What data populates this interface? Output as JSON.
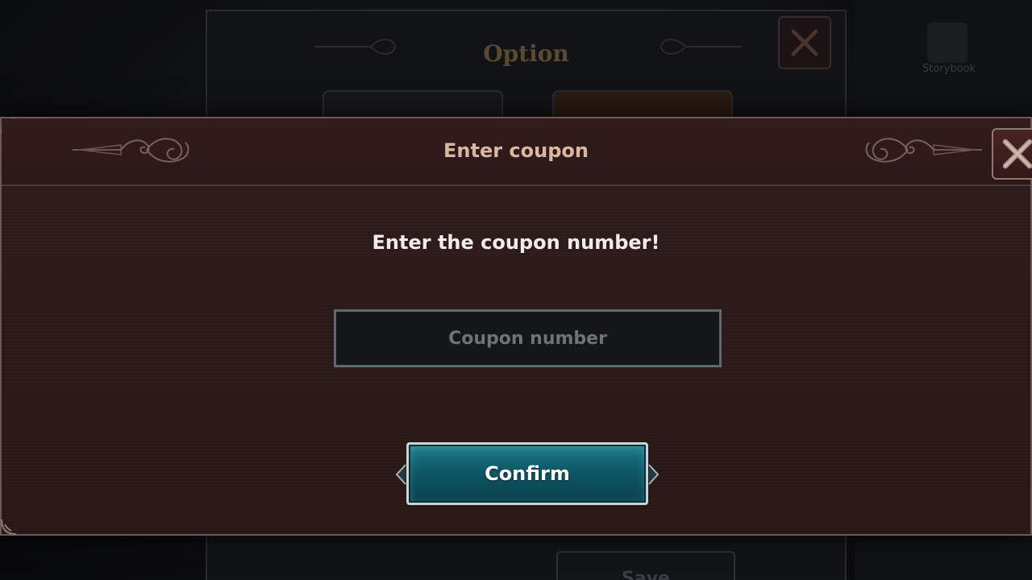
{
  "background": {
    "panel_title": "Option",
    "side_label": "Storybook",
    "save_label": "Save"
  },
  "dialog": {
    "title": "Enter coupon",
    "prompt": "Enter the coupon number!",
    "input": {
      "placeholder": "Coupon number",
      "value": ""
    },
    "confirm_label": "Confirm"
  },
  "icons": {
    "close": "close-icon",
    "ornament": "filigree-ornament-icon",
    "arrow": "diamond-arrow-icon"
  },
  "colors": {
    "dialog_bg": "#2a1717",
    "title_text": "#d8b8a0",
    "confirm_teal": "#0e5866",
    "border": "#6b5a52"
  }
}
